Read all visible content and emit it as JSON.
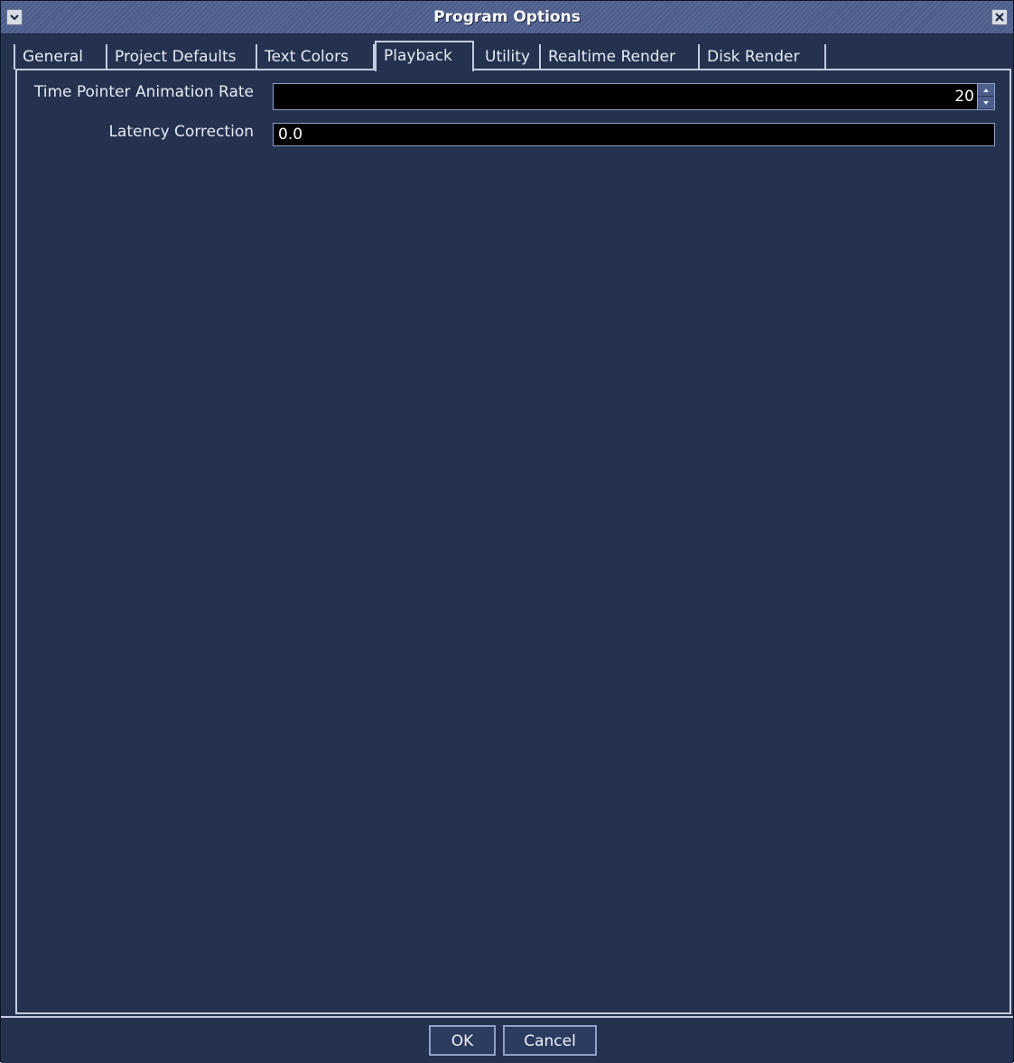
{
  "window": {
    "title": "Program Options"
  },
  "tabs": [
    {
      "label": "General",
      "active": false
    },
    {
      "label": "Project Defaults",
      "active": false
    },
    {
      "label": "Text Colors",
      "active": false
    },
    {
      "label": "Playback",
      "active": true
    },
    {
      "label": "Utility",
      "active": false
    },
    {
      "label": "Realtime Render",
      "active": false
    },
    {
      "label": "Disk Render",
      "active": false
    }
  ],
  "playback": {
    "time_pointer_label": "Time Pointer Animation Rate",
    "time_pointer_value": "20",
    "latency_label": "Latency Correction",
    "latency_value": "0.0"
  },
  "buttons": {
    "ok": "OK",
    "cancel": "Cancel"
  },
  "icons": {
    "window_menu": "chevron-down-icon",
    "window_close": "close-icon",
    "spin_up": "triangle-up-icon",
    "spin_down": "triangle-down-icon"
  },
  "colors": {
    "background": "#243250",
    "titlebar": "#4d5d8c",
    "field_background": "#000000",
    "border": "#c3ccdf"
  }
}
